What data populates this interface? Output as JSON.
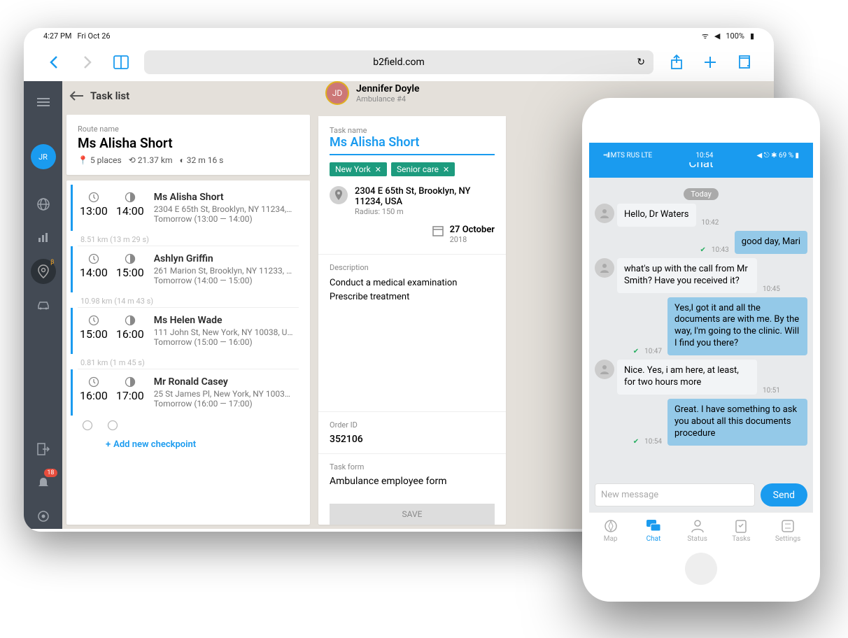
{
  "tablet": {
    "status": {
      "time": "4:27 PM",
      "date": "Fri Oct 26",
      "battery": "100%"
    },
    "url": "b2field.com"
  },
  "sidebar": {
    "avatar": "JR",
    "notif_count": "18",
    "beta": "β"
  },
  "task_list": {
    "header": "Task list",
    "route_label": "Route name",
    "route_name": "Ms Alisha Short",
    "stats": {
      "places": "5 places",
      "distance": "21.37 km",
      "duration": "32 m 16 s"
    },
    "checkpoints": [
      {
        "start": "13:00",
        "end": "14:00",
        "name": "Ms Alisha Short",
        "addr": "2304 E 65th St, Brooklyn, NY 11234, U...",
        "tomorrow": "Tomorrow (13:00 — 14:00)",
        "dist_after": "8.51 km (13 m 29 s)"
      },
      {
        "start": "14:00",
        "end": "15:00",
        "name": "Ashlyn Griffin",
        "addr": "261 Marion St, Brooklyn, NY 11233, U...",
        "tomorrow": "Tomorrow (14:00 — 15:00)",
        "dist_after": "10.98 km (14 m 43 s)"
      },
      {
        "start": "15:00",
        "end": "16:00",
        "name": "Ms Helen Wade",
        "addr": "111 John St, New York, NY 10038, USA",
        "tomorrow": "Tomorrow (15:00 — 16:00)",
        "dist_after": "0.81 km (1 m 45 s)"
      },
      {
        "start": "16:00",
        "end": "17:00",
        "name": "Mr Ronald Casey",
        "addr": "25 St James Pl, New York, NY 10038, U...",
        "tomorrow": "Tomorrow (16:00 — 17:00)",
        "dist_after": ""
      }
    ],
    "add_checkpoint": "Add new checkpoint"
  },
  "task_detail": {
    "assignee_name": "Jennifer Doyle",
    "assignee_sub": "Ambulance #4",
    "task_label": "Task name",
    "task_name": "Ms Alisha Short",
    "tags": [
      "New York",
      "Senior care"
    ],
    "address": "2304 E 65th St, Brooklyn, NY 11234, USA",
    "radius": "Radius: 150 m",
    "date_main": "27 October",
    "date_sub": "2018",
    "desc_label": "Description",
    "description": "Conduct a medical examination\nPrescribe treatment",
    "order_label": "Order ID",
    "order_id": "352106",
    "form_label": "Task form",
    "form_name": "Ambulance employee form",
    "save": "SAVE"
  },
  "phone": {
    "status": {
      "carrier": "MTS RUS   LTE",
      "time": "10:54",
      "battery": "69 %"
    },
    "header": "Chat",
    "day": "Today",
    "messages": [
      {
        "dir": "in",
        "text": "Hello, Dr Waters",
        "time": "10:42",
        "avatar": true
      },
      {
        "dir": "out",
        "text": "good day, Mari",
        "time": "10:43"
      },
      {
        "dir": "in",
        "text": "what's up with the call from Mr Smith? Have you received it?",
        "time": "10:45",
        "avatar": true
      },
      {
        "dir": "out",
        "text": "Yes,I got it and all the documents are with me. By the way, I'm going to the clinic. Will I find you there?",
        "time": "10:47"
      },
      {
        "dir": "in",
        "text": "Nice. Yes, i am here, at least, for two hours more",
        "time": "10:51",
        "avatar": true
      },
      {
        "dir": "out",
        "text": "Great. I have something to ask you about all this documents procedure",
        "time": "10:54"
      }
    ],
    "input_placeholder": "New message",
    "send": "Send",
    "tabs": [
      {
        "label": "Map"
      },
      {
        "label": "Chat",
        "active": true
      },
      {
        "label": "Status"
      },
      {
        "label": "Tasks"
      },
      {
        "label": "Settings"
      }
    ]
  }
}
